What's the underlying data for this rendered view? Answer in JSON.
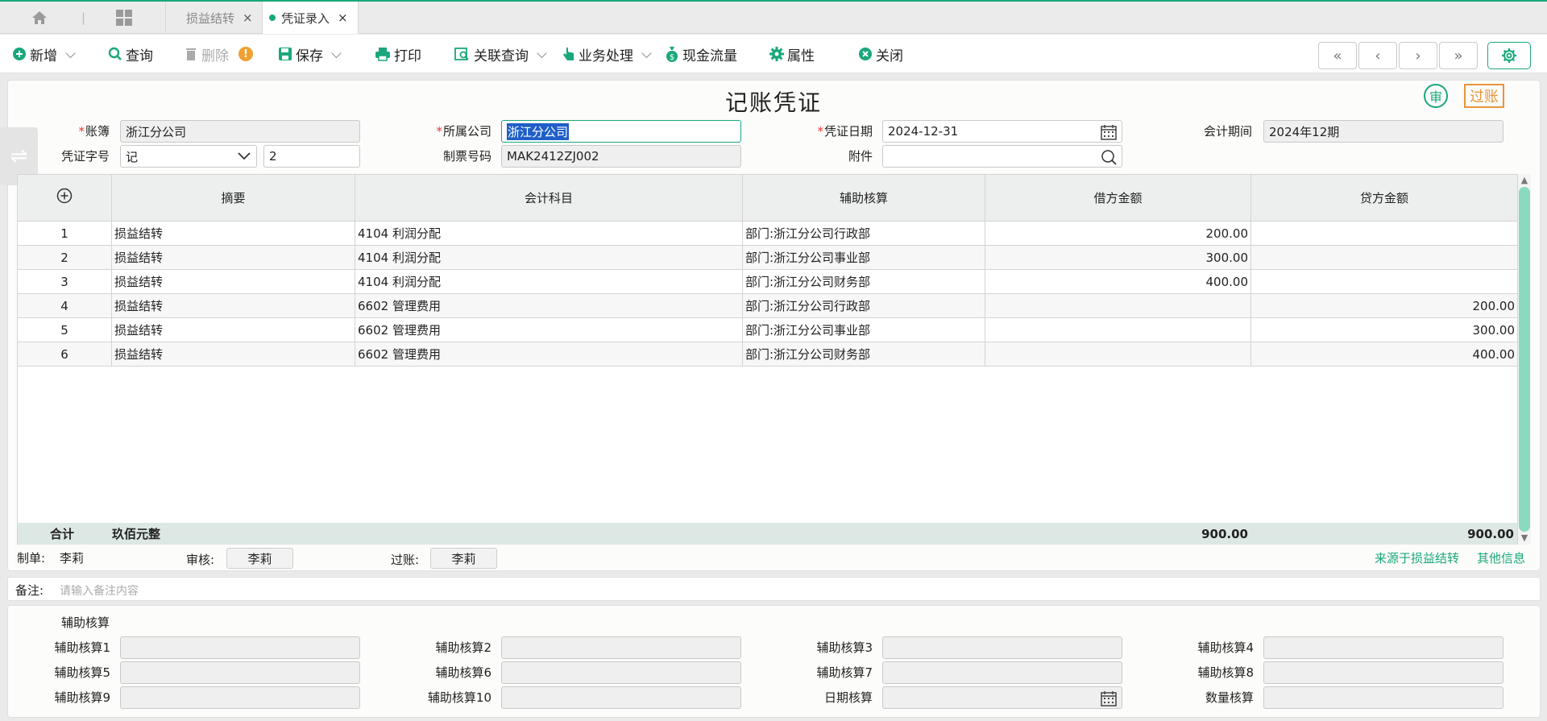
{
  "tabs": {
    "home_icon": "home-icon",
    "apps_icon": "grid-icon",
    "tab1": "损益结转",
    "tab2": "凭证录入",
    "close": "×"
  },
  "toolbar": {
    "add": "新增",
    "query": "查询",
    "delete": "删除",
    "save": "保存",
    "print": "打印",
    "related": "关联查询",
    "business": "业务处理",
    "cashflow": "现金流量",
    "props": "属性",
    "close": "关闭"
  },
  "nav": {
    "first": "«",
    "prev": "‹",
    "next": "›",
    "last": "»"
  },
  "voucher": {
    "title": "记账凭证",
    "badge_audit": "审",
    "badge_posted": "过账",
    "book_label": "账簿",
    "book_value": "浙江分公司",
    "company_label": "所属公司",
    "company_value": "浙江分公司",
    "date_label": "凭证日期",
    "date_value": "2024-12-31",
    "period_label": "会计期间",
    "period_value": "2024年12期",
    "word_label": "凭证字号",
    "word_value": "记",
    "number_value": "2",
    "bill_label": "制票号码",
    "bill_value": "MAK2412ZJ002",
    "attach_label": "附件",
    "attach_value": ""
  },
  "grid": {
    "columns": [
      "摘要",
      "会计科目",
      "辅助核算",
      "借方金额",
      "贷方金额"
    ],
    "rows": [
      {
        "no": "1",
        "summary": "损益结转",
        "account": "4104 利润分配",
        "aux": "部门:浙江分公司行政部",
        "debit": "200.00",
        "credit": ""
      },
      {
        "no": "2",
        "summary": "损益结转",
        "account": "4104 利润分配",
        "aux": "部门:浙江分公司事业部",
        "debit": "300.00",
        "credit": ""
      },
      {
        "no": "3",
        "summary": "损益结转",
        "account": "4104 利润分配",
        "aux": "部门:浙江分公司财务部",
        "debit": "400.00",
        "credit": ""
      },
      {
        "no": "4",
        "summary": "损益结转",
        "account": "6602 管理费用",
        "aux": "部门:浙江分公司行政部",
        "debit": "",
        "credit": "200.00"
      },
      {
        "no": "5",
        "summary": "损益结转",
        "account": "6602 管理费用",
        "aux": "部门:浙江分公司事业部",
        "debit": "",
        "credit": "300.00"
      },
      {
        "no": "6",
        "summary": "损益结转",
        "account": "6602 管理费用",
        "aux": "部门:浙江分公司财务部",
        "debit": "",
        "credit": "400.00"
      }
    ],
    "total_label": "合计",
    "total_words": "玖佰元整",
    "total_debit": "900.00",
    "total_credit": "900.00"
  },
  "signatures": {
    "maker_label": "制单:",
    "maker": "李莉",
    "auditor_label": "审核:",
    "auditor": "李莉",
    "poster_label": "过账:",
    "poster": "李莉",
    "source_link": "来源于损益结转",
    "other_link": "其他信息"
  },
  "remark": {
    "label": "备注:",
    "placeholder": "请输入备注内容"
  },
  "aux": {
    "title": "辅助核算",
    "labels": [
      "辅助核算1",
      "辅助核算2",
      "辅助核算3",
      "辅助核算4",
      "辅助核算5",
      "辅助核算6",
      "辅助核算7",
      "辅助核算8",
      "辅助核算9",
      "辅助核算10",
      "日期核算",
      "数量核算"
    ]
  },
  "colors": {
    "accent": "#1aa77c",
    "warning": "#e8953a",
    "required": "#e53935",
    "selection": "#1f5fc8"
  }
}
